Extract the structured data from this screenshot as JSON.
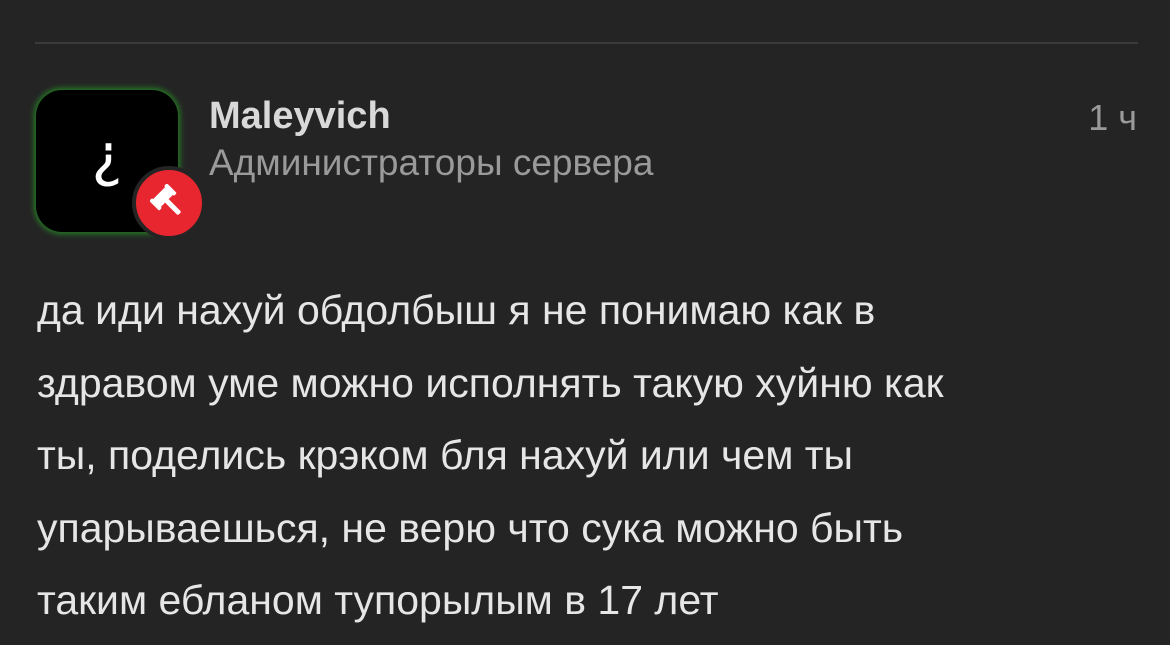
{
  "post": {
    "author": {
      "username": "Maleyvich",
      "role": "Администраторы сервера",
      "avatar_glyph": "¿",
      "avatar_glow_color": "#28c828",
      "badge_icon": "gavel-icon",
      "badge_color": "#e8262f"
    },
    "timestamp": "1 ч",
    "message": "да иди нахуй обдолбыш я не понимаю как в\nздравом уме можно исполнять такую хуйню как\nты, поделись крэком бля нахуй или чем ты\nупарываешься, не верю что сука можно быть\nтаким ебланом тупорылым в 17 лет"
  }
}
